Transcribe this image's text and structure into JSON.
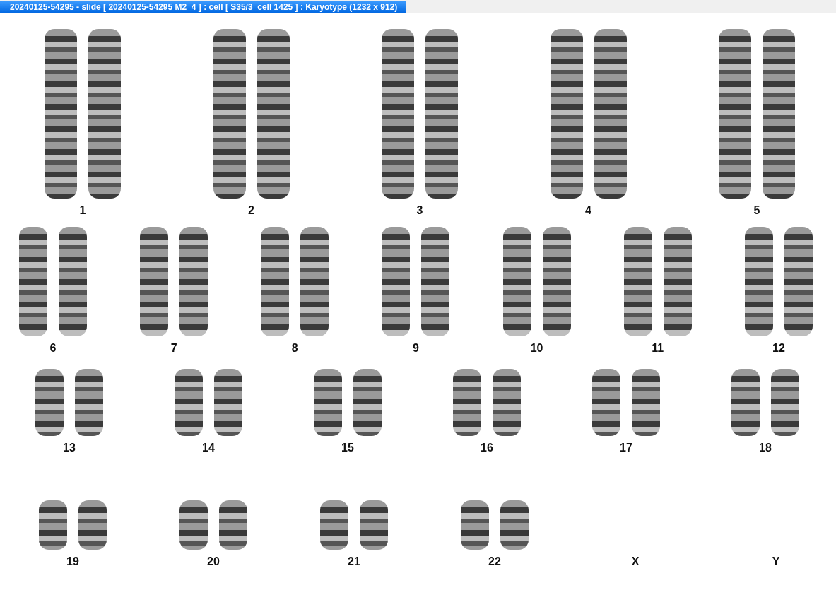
{
  "window": {
    "title": "20240125-54295 - slide [ 20240125-54295 M2_4 ] : cell [ S35/3_cell 1425 ] : Karyotype  (1232 x 912)"
  },
  "rows": [
    {
      "groups": [
        {
          "label": "1",
          "kind": "pair"
        },
        {
          "label": "2",
          "kind": "pair"
        },
        {
          "label": "3",
          "kind": "pair"
        },
        {
          "label": "4",
          "kind": "pair"
        },
        {
          "label": "5",
          "kind": "pair"
        }
      ]
    },
    {
      "groups": [
        {
          "label": "6",
          "kind": "pair"
        },
        {
          "label": "7",
          "kind": "pair"
        },
        {
          "label": "8",
          "kind": "pair"
        },
        {
          "label": "9",
          "kind": "pair"
        },
        {
          "label": "10",
          "kind": "pair"
        },
        {
          "label": "11",
          "kind": "pair"
        },
        {
          "label": "12",
          "kind": "pair"
        }
      ]
    },
    {
      "groups": [
        {
          "label": "13",
          "kind": "pair"
        },
        {
          "label": "14",
          "kind": "pair"
        },
        {
          "label": "15",
          "kind": "pair"
        },
        {
          "label": "16",
          "kind": "pair"
        },
        {
          "label": "17",
          "kind": "pair"
        },
        {
          "label": "18",
          "kind": "pair"
        }
      ]
    },
    {
      "groups": [
        {
          "label": "19",
          "kind": "pair"
        },
        {
          "label": "20",
          "kind": "pair"
        },
        {
          "label": "21",
          "kind": "pair"
        },
        {
          "label": "22",
          "kind": "pair"
        },
        {
          "label": "X",
          "kind": "empty"
        },
        {
          "label": "Y",
          "kind": "empty"
        }
      ]
    }
  ]
}
